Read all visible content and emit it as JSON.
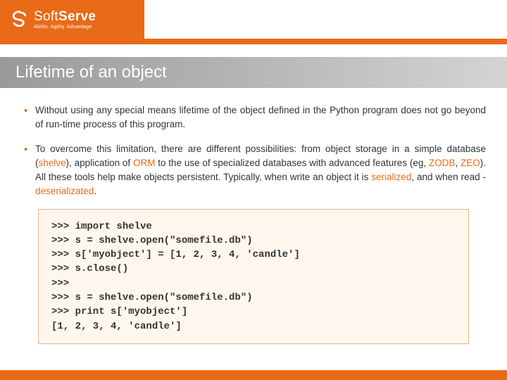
{
  "logo": {
    "name_light": "Soft",
    "name_bold": "Serve",
    "tagline": "Ability. Agility. Advantage."
  },
  "title": "Lifetime of an object",
  "bullets": [
    {
      "text": "Without using any special means lifetime of the object defined in the Python program does not go beyond of run-time process of this program."
    },
    {
      "prefix": "To overcome this limitation, there are different possibilities: from object storage in a simple database (",
      "hl1": "shelve",
      "mid1": "), application of ",
      "hl2": "ORM",
      "mid2": " to the use of specialized databases with advanced features (eg, ",
      "hl3": "ZODB",
      "mid3": ", ",
      "hl4": "ZEO",
      "mid4": "). All these tools help make objects persistent. Typically, when write an object it is ",
      "hl5": "serialized",
      "mid5": ", and when read - ",
      "hl6": "deserializated",
      "suffix": "."
    }
  ],
  "code": ">>> import shelve\n>>> s = shelve.open(\"somefile.db\")\n>>> s['myobject'] = [1, 2, 3, 4, 'candle']\n>>> s.close()\n>>>\n>>> s = shelve.open(\"somefile.db\")\n>>> print s['myobject']\n[1, 2, 3, 4, 'candle']"
}
